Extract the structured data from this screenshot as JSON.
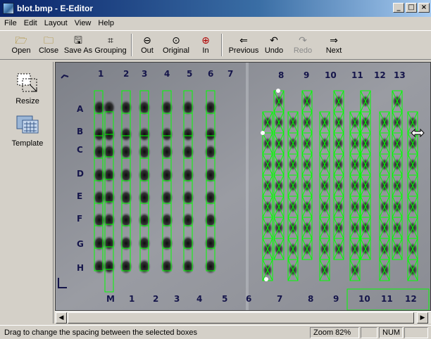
{
  "window": {
    "title": "blot.bmp - E-Editor",
    "minimize": "_",
    "maximize": "□",
    "close": "×"
  },
  "menu": [
    "File",
    "Edit",
    "Layout",
    "View",
    "Help"
  ],
  "toolbar": {
    "open": "Open",
    "close": "Close",
    "save_as": "Save As",
    "grouping": "Grouping",
    "zoom_out": "Out",
    "zoom_original": "Original",
    "zoom_in": "In",
    "previous": "Previous",
    "undo": "Undo",
    "redo": "Redo",
    "next": "Next"
  },
  "tools": {
    "resize": "Resize",
    "template": "Template"
  },
  "blot": {
    "left_numbers": [
      "1",
      "2",
      "3",
      "4",
      "5",
      "6",
      "7"
    ],
    "right_numbers": [
      "8",
      "9",
      "10",
      "11",
      "12",
      "13"
    ],
    "row_letters": [
      "A",
      "B",
      "C",
      "D",
      "E",
      "F",
      "G",
      "H"
    ],
    "bottom_labels": [
      "M",
      "1",
      "2",
      "3",
      "4",
      "5",
      "6",
      "7",
      "8",
      "9",
      "10",
      "11",
      "12"
    ]
  },
  "status": {
    "message": "Drag to change the spacing between the selected boxes",
    "zoom": "Zoom 82%",
    "num": "NUM"
  },
  "colors": {
    "box": "#00ff00",
    "titlebar": "#0a246a"
  }
}
